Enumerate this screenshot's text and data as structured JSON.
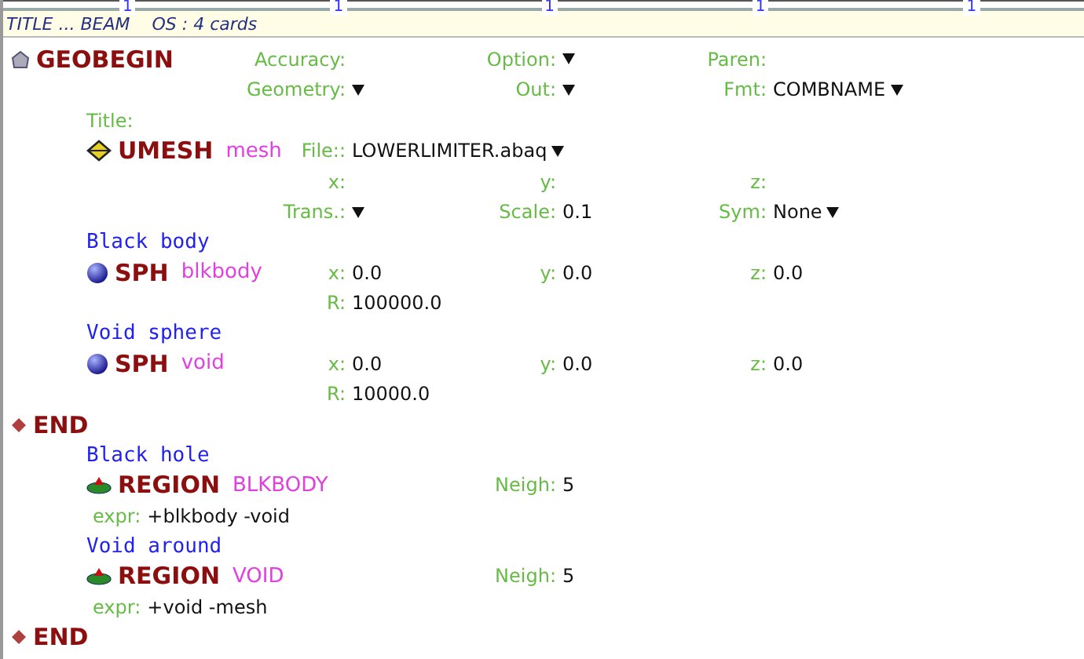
{
  "title_bar": {
    "text_left": "TITLE ... BEAM",
    "text_right": "OS : 4 cards"
  },
  "ruler_marks": [
    "1",
    "1",
    "1",
    "1",
    "1"
  ],
  "cards": [
    {
      "kind": "geobegin",
      "keyword": "GEOBEGIN",
      "rows": [
        [
          {
            "label": "Accuracy:"
          },
          {
            "label": "Option:",
            "dropdown": true
          },
          {
            "label": "Paren:"
          }
        ],
        [
          {
            "label": "Geometry:",
            "dropdown": true
          },
          {
            "label": "Out:",
            "dropdown": true
          },
          {
            "label": "Fmt:",
            "value": "COMBNAME",
            "dropdown": true
          }
        ]
      ],
      "title_label": "Title:",
      "children": [
        {
          "kind": "umesh",
          "keyword": "UMESH",
          "name": "mesh",
          "rows": [
            [
              {
                "label": "File::",
                "value": "LOWERLIMITER.abaq",
                "dropdown": true
              }
            ],
            [
              {
                "label": "x:"
              },
              {
                "label": "y:"
              },
              {
                "label": "z:"
              }
            ],
            [
              {
                "label": "Trans.:",
                "dropdown": true
              },
              {
                "label": "Scale:",
                "value": "0.1"
              },
              {
                "label": "Sym:",
                "value": "None",
                "dropdown": true
              }
            ]
          ]
        },
        {
          "kind": "sph",
          "comment": "Black body",
          "keyword": "SPH",
          "name": "blkbody",
          "rows": [
            [
              {
                "label": "x:",
                "value": "0.0"
              },
              {
                "label": "y:",
                "value": "0.0"
              },
              {
                "label": "z:",
                "value": "0.0"
              }
            ],
            [
              {
                "label": "R:",
                "value": "100000.0"
              }
            ]
          ]
        },
        {
          "kind": "sph",
          "comment": "Void sphere",
          "keyword": "SPH",
          "name": "void",
          "rows": [
            [
              {
                "label": "x:",
                "value": "0.0"
              },
              {
                "label": "y:",
                "value": "0.0"
              },
              {
                "label": "z:",
                "value": "0.0"
              }
            ],
            [
              {
                "label": "R:",
                "value": "10000.0"
              }
            ]
          ]
        }
      ]
    },
    {
      "kind": "end",
      "keyword": "END",
      "children": [
        {
          "kind": "region",
          "comment": "Black hole",
          "keyword": "REGION",
          "name": "BLKBODY",
          "rows": [
            [
              null,
              {
                "label": "Neigh:",
                "value": "5"
              }
            ]
          ],
          "expr_label": "expr:",
          "expr": "+blkbody -void"
        },
        {
          "kind": "region",
          "comment": "Void around",
          "keyword": "REGION",
          "name": "VOID",
          "rows": [
            [
              null,
              {
                "label": "Neigh:",
                "value": "5"
              }
            ]
          ],
          "expr_label": "expr:",
          "expr": "+void -mesh"
        }
      ]
    },
    {
      "kind": "end",
      "keyword": "END"
    }
  ]
}
